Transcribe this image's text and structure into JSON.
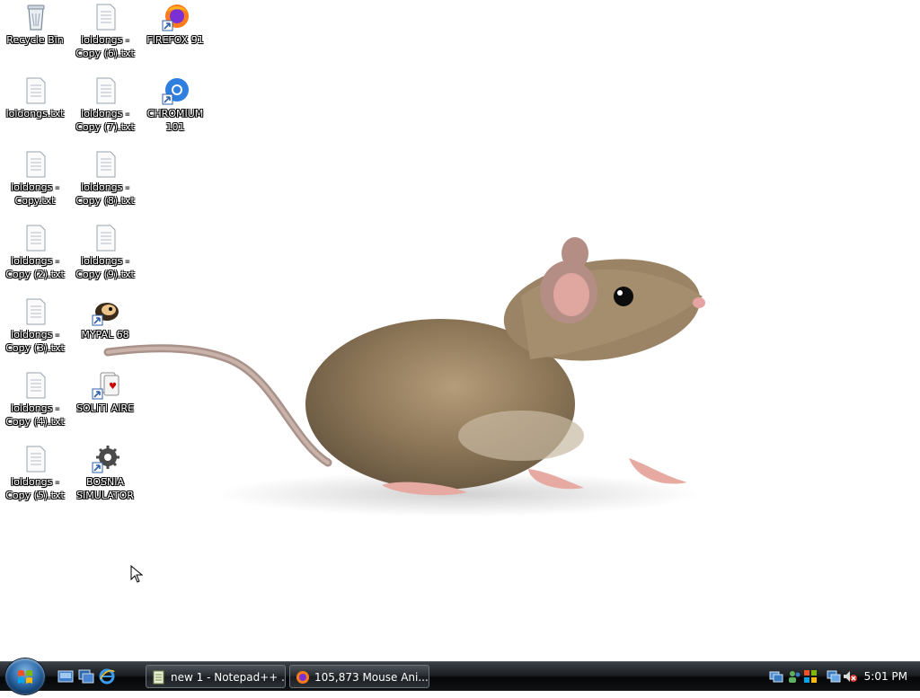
{
  "desktop": {
    "icons": [
      {
        "label": "Recycle Bin",
        "icon": "recycle-bin-icon"
      },
      {
        "label": "loldongs.txt",
        "icon": "text-file-icon"
      },
      {
        "label": "loldongs - Copy.txt",
        "icon": "text-file-icon"
      },
      {
        "label": "loldongs - Copy (2).txt",
        "icon": "text-file-icon"
      },
      {
        "label": "loldongs - Copy (3).txt",
        "icon": "text-file-icon"
      },
      {
        "label": "loldongs - Copy (4).txt",
        "icon": "text-file-icon"
      },
      {
        "label": "loldongs - Copy (5).txt",
        "icon": "text-file-icon"
      },
      {
        "label": "loldongs - Copy (6).txt",
        "icon": "text-file-icon"
      },
      {
        "label": "loldongs - Copy (7).txt",
        "icon": "text-file-icon"
      },
      {
        "label": "loldongs - Copy (8).txt",
        "icon": "text-file-icon"
      },
      {
        "label": "loldongs - Copy (9).txt",
        "icon": "text-file-icon"
      },
      {
        "label": "MYPAL 68",
        "icon": "mypal-shortcut-icon"
      },
      {
        "label": "SOLITI AIRE",
        "icon": "solitaire-shortcut-icon"
      },
      {
        "label": "BOSNIA SIMULATOR",
        "icon": "gear-shortcut-icon"
      },
      {
        "label": "FIREFOX 91",
        "icon": "firefox-shortcut-icon"
      },
      {
        "label": "CHROMIUM 101",
        "icon": "chromium-shortcut-icon"
      }
    ]
  },
  "wallpaper": {
    "subject": "mouse-photo"
  },
  "taskbar": {
    "quick_launch": [
      "show-desktop-icon",
      "switch-windows-icon",
      "internet-explorer-icon"
    ],
    "buttons": [
      {
        "label": "new 1 - Notepad++ ...",
        "icon": "notepad-plus-plus-icon"
      },
      {
        "label": "105,873 Mouse Ani...",
        "icon": "firefox-icon"
      }
    ],
    "tray_icons": [
      "network-icon",
      "users-icon",
      "windows-update-icon",
      "network-connection-icon",
      "volume-muted-icon"
    ],
    "clock": "5:01 PM"
  }
}
